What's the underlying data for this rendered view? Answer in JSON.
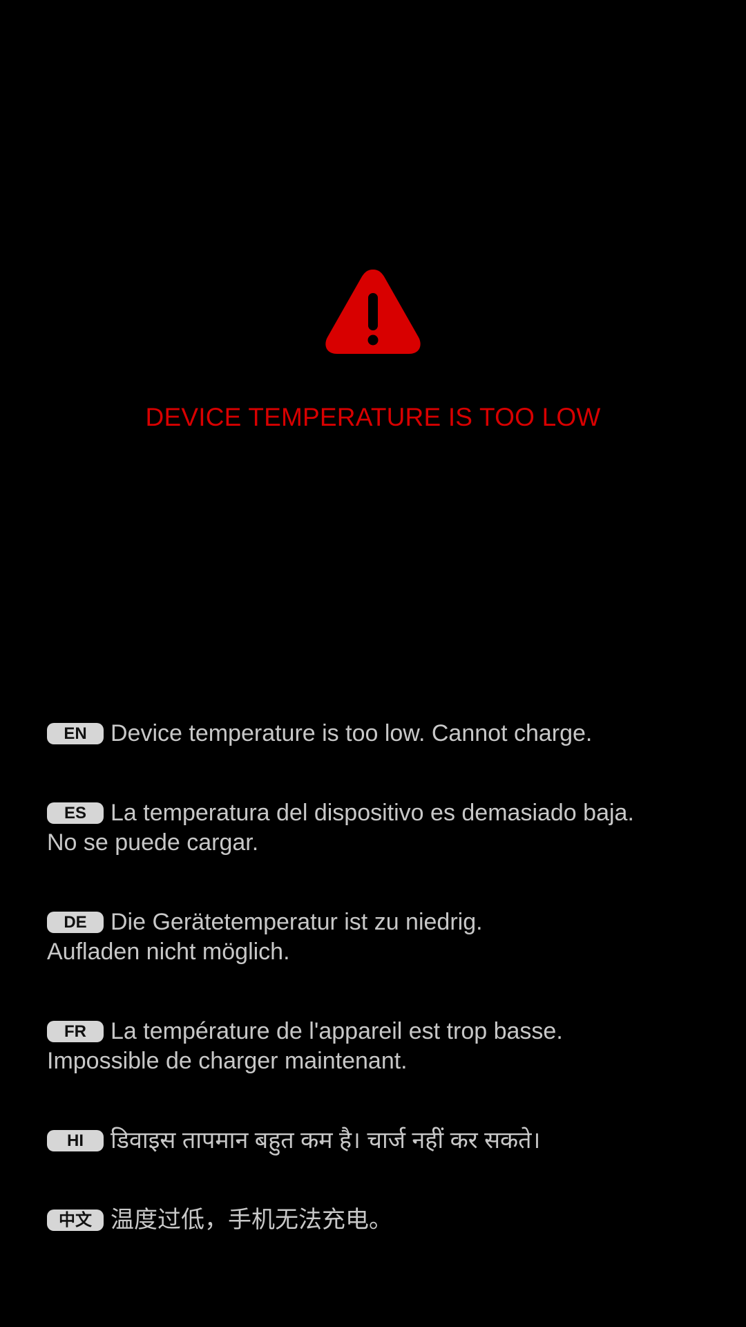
{
  "alert": {
    "icon": "warning-triangle-icon",
    "title": "DEVICE TEMPERATURE IS TOO LOW",
    "color": "#d80000"
  },
  "messages": [
    {
      "lang": "EN",
      "line1": "Device temperature is too low. Cannot charge.",
      "line2": ""
    },
    {
      "lang": "ES",
      "line1": "La temperatura del dispositivo es demasiado baja.",
      "line2": "No se puede cargar."
    },
    {
      "lang": "DE",
      "line1": "Die Gerätetemperatur ist zu niedrig.",
      "line2": "Aufladen nicht möglich."
    },
    {
      "lang": "FR",
      "line1": "La température de l'appareil est trop basse.",
      "line2": "Impossible de charger maintenant."
    },
    {
      "lang": "HI",
      "line1": "डिवाइस तापमान बहुत कम है। चार्ज नहीं कर सकते।",
      "line2": ""
    },
    {
      "lang": "中文",
      "line1": "温度过低，手机无法充电。",
      "line2": ""
    }
  ]
}
